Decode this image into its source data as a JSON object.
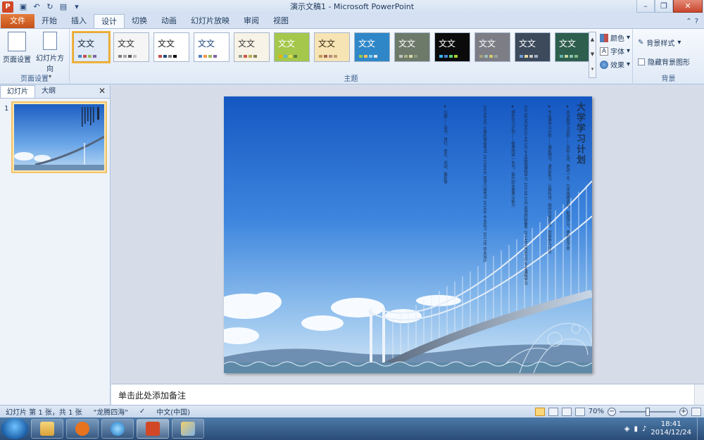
{
  "window": {
    "title": "演示文稿1 - Microsoft PowerPoint",
    "app_letter": "P"
  },
  "qat": [
    "save-icon",
    "undo-icon",
    "redo-icon",
    "new-icon",
    "customize-icon"
  ],
  "tabs": [
    {
      "label": "文件",
      "kind": "file"
    },
    {
      "label": "开始"
    },
    {
      "label": "插入"
    },
    {
      "label": "设计",
      "kind": "active"
    },
    {
      "label": "切换"
    },
    {
      "label": "动画"
    },
    {
      "label": "幻灯片放映"
    },
    {
      "label": "审阅"
    },
    {
      "label": "视图"
    }
  ],
  "ribbon": {
    "page_setup": {
      "page_setup_label": "页面设置",
      "orientation_label": "幻灯片方向",
      "group_label": "页面设置"
    },
    "themes": {
      "group_label": "主题",
      "sample_text": "文文",
      "items": [
        {
          "bg": "#dfeaf6",
          "fg": "#1e2b3c",
          "selected": true,
          "bars": [
            "#4f81bd",
            "#c0504d",
            "#9bbb59",
            "#8064a2"
          ]
        },
        {
          "bg": "#f5f5f5",
          "fg": "#333333",
          "bars": [
            "#7f7f7f",
            "#a5a5a5",
            "#595959",
            "#c0c0c0"
          ]
        },
        {
          "bg": "#ffffff",
          "fg": "#222222",
          "bars": [
            "#c0504d",
            "#1f497d",
            "#7f7f7f",
            "#000000"
          ]
        },
        {
          "bg": "#ffffff",
          "fg": "#1f497d",
          "bars": [
            "#4f81bd",
            "#f79646",
            "#9bbb59",
            "#8064a2"
          ]
        },
        {
          "bg": "#f7f3e6",
          "fg": "#3b3b3b",
          "bars": [
            "#93a299",
            "#cf543f",
            "#b5ae53",
            "#848058"
          ]
        },
        {
          "bg": "#a5c74c",
          "fg": "#ffffff",
          "bars": [
            "#f0ad00",
            "#60b5cc",
            "#e6df44",
            "#5a7e3c"
          ]
        },
        {
          "bg": "#f6e4b5",
          "fg": "#3b2a10",
          "bars": [
            "#c19859",
            "#a5644e",
            "#b58b80",
            "#c3986d"
          ]
        },
        {
          "bg": "#2f87c8",
          "fg": "#ffffff",
          "bars": [
            "#94c954",
            "#f3c05a",
            "#7fd0f2",
            "#e6e6e6"
          ]
        },
        {
          "bg": "#6d7a6a",
          "fg": "#ffffff",
          "bars": [
            "#c3c3c3",
            "#a7b789",
            "#d8d8a8",
            "#8b9a7a"
          ]
        },
        {
          "bg": "#0b0b0b",
          "fg": "#ffffff",
          "bars": [
            "#31b6fd",
            "#4584d3",
            "#5bd078",
            "#a5d028"
          ]
        },
        {
          "bg": "#7d7d86",
          "fg": "#ffffff",
          "bars": [
            "#a9a57c",
            "#9cbebd",
            "#d2cb6c",
            "#95a39d"
          ]
        },
        {
          "bg": "#3c4a5c",
          "fg": "#ffffff",
          "bars": [
            "#6f9ed3",
            "#e2d8a5",
            "#c7c7c7",
            "#a0b0c8"
          ]
        },
        {
          "bg": "#2e5e4e",
          "fg": "#ffffff",
          "bars": [
            "#69b3a8",
            "#c3d69b",
            "#88c4ae",
            "#7ebc89"
          ]
        }
      ]
    },
    "variants": {
      "colors_label": "颜色",
      "fonts_label": "字体",
      "effects_label": "效果"
    },
    "background": {
      "styles_label": "背景样式",
      "hide_graphics_label": "隐藏背景图形",
      "group_label": "背景"
    }
  },
  "left_pane": {
    "tab_slides": "幻灯片",
    "tab_outline": "大纲",
    "slide_number": "1"
  },
  "slide": {
    "title": "大学学习计划",
    "columns": [
      "★ 本学期学习目标——目标上进、更进一步，力求成绩优异，取得学分，拿到奖学金",
      "★ 专业课学习计划——课前预习、课后复习，认真听讲，按时完成作业，积极参与讨论",
      "2013年9月至2014年1月 专业基础课程学习 2013年10月 英语四级备考 2014年3月至7月 专业课程学习",
      "★ 课外学习计划——每周阅读一本书，提升综合素质与能力",
      "2014年9月 计算机等级考试 2015年6月 英语六级考试 2016年 专业实习 2017年 毕业设计",
      "★ 兴趣——读书、旅行、音乐、运动、摄影等"
    ]
  },
  "notes": {
    "placeholder": "单击此处添加备注"
  },
  "status": {
    "slide_info": "幻灯片 第 1 张，共 1 张",
    "theme_name": "\"龙腾四海\"",
    "language": "中文(中国)",
    "zoom": "70%"
  },
  "taskbar": {
    "time": "18:41",
    "date": "2014/12/24"
  }
}
